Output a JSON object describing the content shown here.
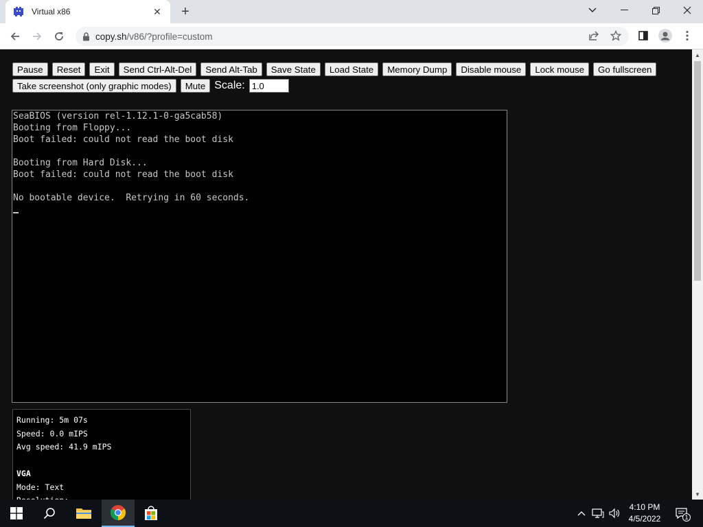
{
  "browser": {
    "tab_title": "Virtual x86",
    "url_host": "copy.sh",
    "url_path": "/v86/?profile=custom"
  },
  "controls": {
    "row1": [
      "Pause",
      "Reset",
      "Exit",
      "Send Ctrl-Alt-Del",
      "Send Alt-Tab",
      "Save State",
      "Load State",
      "Memory Dump",
      "Disable mouse",
      "Lock mouse",
      "Go fullscreen"
    ],
    "row2": [
      "Take screenshot (only graphic modes)",
      "Mute"
    ],
    "scale_label": "Scale:",
    "scale_value": "1.0"
  },
  "screen": {
    "lines": [
      "SeaBIOS (version rel-1.12.1-0-ga5cab58)",
      "Booting from Floppy...",
      "Boot failed: could not read the boot disk",
      "",
      "Booting from Hard Disk...",
      "Boot failed: could not read the boot disk",
      "",
      "No bootable device.  Retrying in 60 seconds."
    ]
  },
  "stats": {
    "running": "Running: 5m 07s",
    "speed": "Speed: 0.0 mIPS",
    "avg_speed": "Avg speed: 41.9 mIPS",
    "vga_header": "VGA",
    "mode": "Mode: Text",
    "resolution": "Resolution:"
  },
  "taskbar": {
    "time": "4:10 PM",
    "date": "4/5/2022",
    "notification_count": "1"
  },
  "colors": {
    "page_bg": "#101010",
    "tab_strip": "#dee1e6",
    "taskbar": "#0d1117",
    "accent": "#76b9ed"
  }
}
